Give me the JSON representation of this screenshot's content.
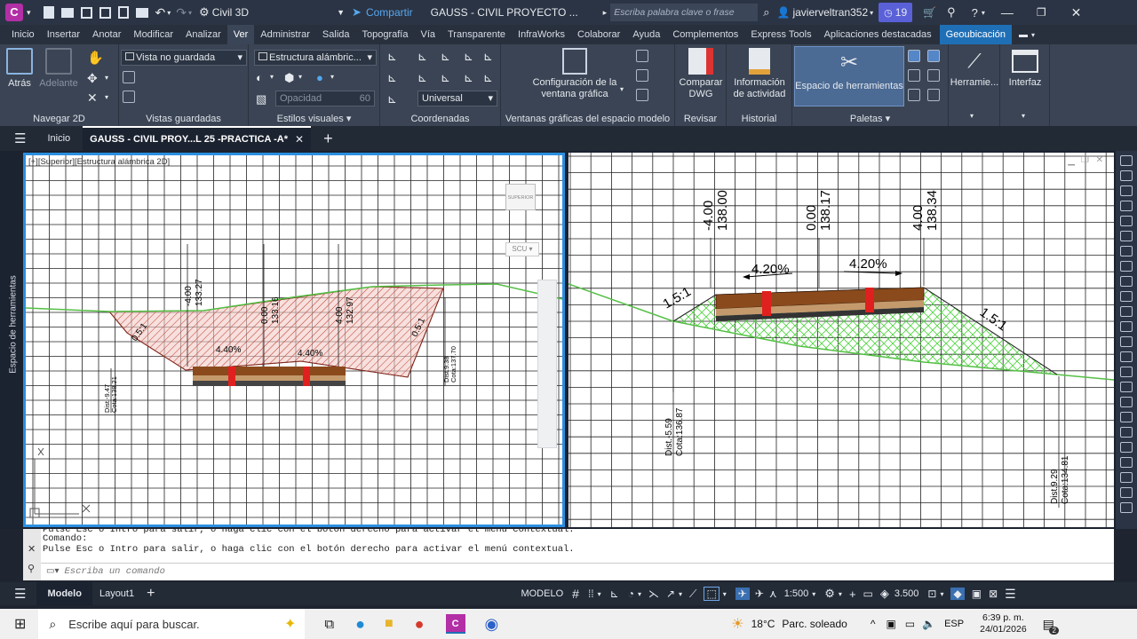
{
  "titlebar": {
    "app_letter": "C",
    "workspace": "Civil 3D",
    "share_label": "Compartir",
    "doc_title": "GAUSS - CIVIL PROYECTO ...",
    "search_placeholder": "Escriba palabra clave o frase",
    "user": "javierveltran352",
    "notif_count": "19"
  },
  "menu": {
    "items": [
      "Inicio",
      "Insertar",
      "Anotar",
      "Modificar",
      "Analizar",
      "Ver",
      "Administrar",
      "Salida",
      "Topografía",
      "Vía",
      "Transparente",
      "InfraWorks",
      "Colaborar",
      "Ayuda",
      "Complementos",
      "Express Tools",
      "Aplicaciones destacadas",
      "Geoubicación"
    ],
    "active": "Ver"
  },
  "ribbon": {
    "nav": {
      "back": "Atrás",
      "forward": "Adelante",
      "label": "Navegar 2D"
    },
    "views": {
      "combo": "Vista no guardada",
      "label": "Vistas guardadas"
    },
    "styles": {
      "combo": "Estructura alámbric...",
      "opacity": "Opacidad",
      "opacity_val": "60",
      "label": "Estilos visuales"
    },
    "coords": {
      "combo": "Universal",
      "label": "Coordenadas"
    },
    "viewports": {
      "config": "Configuración de la ventana gráfica",
      "label": "Ventanas gráficas del espacio modelo"
    },
    "review": {
      "compare": "Comparar DWG",
      "label": "Revisar"
    },
    "history": {
      "info": "Información de actividad",
      "label": "Historial"
    },
    "palettes": {
      "tool": "Espacio de herramientas",
      "label": "Paletas"
    },
    "tools": {
      "label": "Herramie..."
    },
    "ui": {
      "label": "Interfaz"
    }
  },
  "doctabs": {
    "home": "Inicio",
    "active": "GAUSS - CIVIL PROY...L 25 -PRACTICA -A*"
  },
  "left_vp": {
    "caption": "[+][Superior][Estructura alámbrica 2D]",
    "viewcube": "SUPERIOR",
    "wcs": "SCU",
    "labels": {
      "l1a": "-4.00",
      "l1b": "133.27",
      "l2a": "0.00",
      "l2b": "133.16",
      "l3a": "4.00",
      "l3b": "132.97",
      "pct_l": "4.40%",
      "pct_r": "4.40%",
      "slope_l": "0.5:1",
      "slope_r": "0.5:1",
      "dist_l": "Dist.-9.47",
      "cota_l": "Cota:138.21",
      "dist_r": "Dist.9.38",
      "cota_r": "Cota:137.70"
    }
  },
  "right_vp": {
    "labels": {
      "l1a": "-4.00",
      "l1b": "138.00",
      "l2a": "0.00",
      "l2b": "138.17",
      "l3a": "4.00",
      "l3b": "138.34",
      "pct_l": "4.20%",
      "pct_r": "4.20%",
      "slope_l": "1.5:1",
      "slope_r": "1.5:1",
      "dist_l": "Dist.-5.59",
      "cota_l": "Cota:136.87",
      "dist_r": "Dist.9.29",
      "cota_r": "Cota:134.81"
    }
  },
  "sidepanel": {
    "label": "Espacio de herramientas"
  },
  "command": {
    "line1": "Pulse Esc o Intro para salir, o haga clic con el botón derecho para activar el menú contextual.",
    "line2": "Comando:",
    "line3": "Pulse Esc o Intro para salir, o haga clic con el botón derecho para activar el menú contextual.",
    "placeholder": "Escriba un comando"
  },
  "statusbar": {
    "model_tab": "Modelo",
    "layout_tab": "Layout1",
    "mode": "MODELO",
    "scale": "1:500",
    "value": "3.500"
  },
  "taskbar": {
    "search": "Escribe aquí para buscar.",
    "temp": "18°C",
    "weather": "Parc. soleado",
    "lang": "ESP",
    "time": "6:39 p. m.",
    "date": "24/01/2026",
    "notif": "2"
  }
}
